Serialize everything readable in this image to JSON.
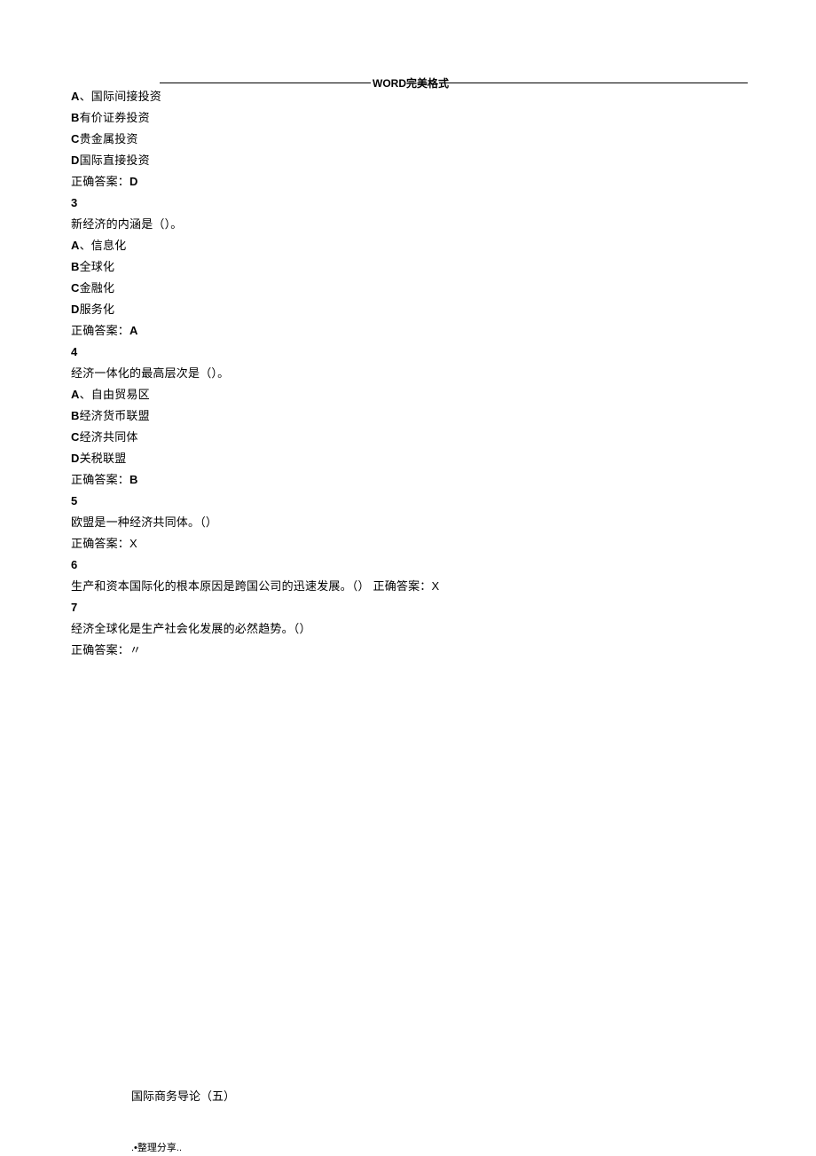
{
  "header": {
    "title": "WORD完美格式"
  },
  "lines": {
    "l1_a": "A",
    "l1_txt": "、国际间接投资",
    "l2_a": "B",
    "l2_txt": "有价证券投资",
    "l3_a": "C",
    "l3_txt": "贵金属投资",
    "l4_a": "D",
    "l4_txt": "国际直接投资",
    "l5_pre": "正确答案：",
    "l5_ans": "D",
    "q3": "3",
    "l6": "新经济的内涵是（）。",
    "l7_a": "A",
    "l7_txt": "、信息化",
    "l8_a": "B",
    "l8_txt": "全球化",
    "l9_a": "C",
    "l9_txt": "金融化",
    "l10_a": "D",
    "l10_txt": "服务化",
    "l11_pre": "正确答案：",
    "l11_ans": "A",
    "q4": "4",
    "l12": "经济一体化的最高层次是（）。",
    "l13_a": "A",
    "l13_txt": "、自由贸易区",
    "l14_a": "B",
    "l14_txt": "经济货币联盟",
    "l15_a": "C",
    "l15_txt": "经济共同体",
    "l16_a": "D",
    "l16_txt": "关税联盟",
    "l17_pre": "正确答案：",
    "l17_ans": "B",
    "q5": "5",
    "l18": "欧盟是一种经济共同体。（）",
    "l19_pre": "正确答案：",
    "l19_ans": "X",
    "q6": "6",
    "l20_a": "生产和资本国际化的根本原因是跨国公司的迅速发展。（）  正确答案：",
    "l20_ans": "X",
    "q7": "7",
    "l21": "经济全球化是生产社会化发展的必然趋势。（）",
    "l22": "正确答案：〃"
  },
  "section": {
    "title": "国际商务导论（五）"
  },
  "footer": {
    "text": ".•整理分享.."
  }
}
